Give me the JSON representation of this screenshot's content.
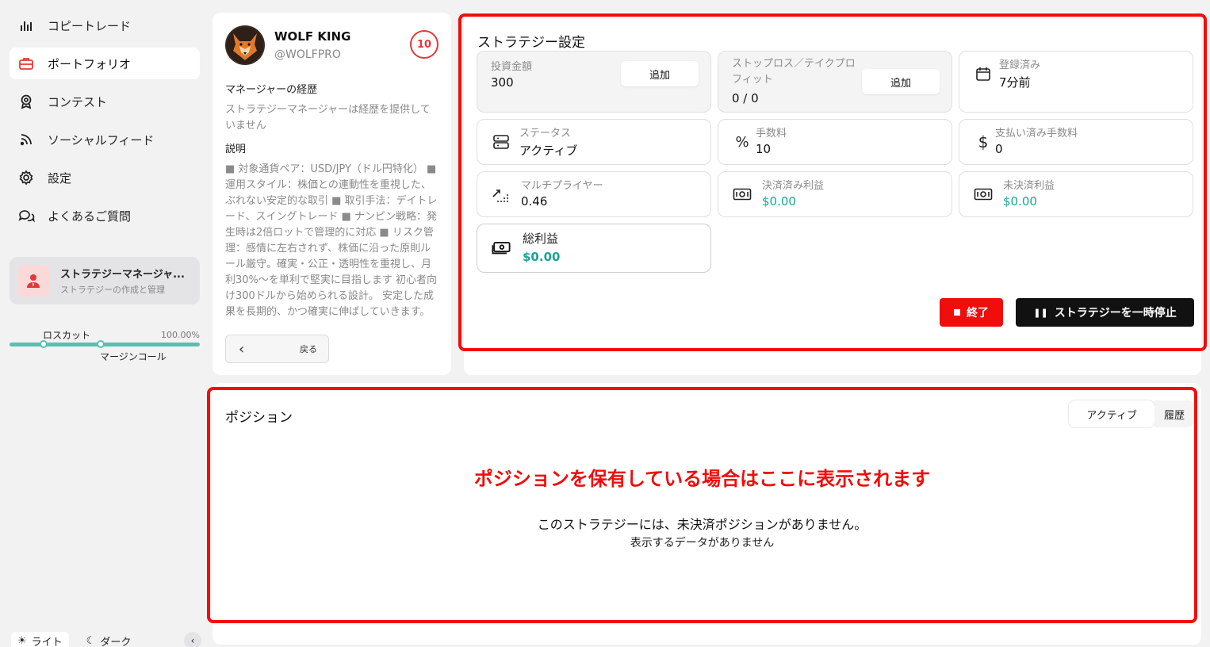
{
  "sidebar": {
    "nav": [
      {
        "label": "コピートレード",
        "icon": "bar-chart-icon"
      },
      {
        "label": "ポートフォリオ",
        "icon": "briefcase-icon"
      },
      {
        "label": "コンテスト",
        "icon": "award-icon"
      },
      {
        "label": "ソーシャルフィード",
        "icon": "rss-icon"
      },
      {
        "label": "設定",
        "icon": "gear-icon"
      },
      {
        "label": "よくあるご質問",
        "icon": "chat-icon"
      }
    ],
    "active_index": 1,
    "manager_card": {
      "title": "ストラテジーマネージャ...",
      "subtitle": "ストラテジーの作成と管理"
    },
    "risk": {
      "stop_label": "ロスカット",
      "percent": "100.00%",
      "margin_label": "マージンコール"
    },
    "theme": {
      "light": "ライト",
      "dark": "ダーク"
    }
  },
  "profile": {
    "name": "WOLF KING",
    "handle": "@WOLFPRO",
    "score": "10",
    "history_title": "マネージャーの経歴",
    "history_text": "ストラテジーマネージャーは経歴を提供していません",
    "desc_title": "説明",
    "description": "■ 対象通貨ペア：USD/JPY（ドル円特化） ■ 運用スタイル：株価との連動性を重視した、ぶれない安定的な取引 ■ 取引手法：デイトレード、スイングトレード ■ ナンピン戦略：発生時は2倍ロットで管理的に対応 ■ リスク管理：感情に左右されず、株価に沿った原則ルール厳守。確実・公正・透明性を重視し、月利30%〜を単利で堅実に目指します 初心者向け300ドルから始められる設計。 安定した成果を長期的、かつ確実に伸ばしていきます。",
    "back_label": "戻る"
  },
  "strategy": {
    "title": "ストラテジー設定",
    "investment": {
      "label": "投資金額",
      "value": "300",
      "button": "追加"
    },
    "sltp": {
      "label": "ストップロス／テイクプロフィット",
      "value": "0 / 0",
      "button": "追加"
    },
    "registered": {
      "label": "登録済み",
      "value": "7分前"
    },
    "status": {
      "label": "ステータス",
      "value": "アクティブ"
    },
    "fee": {
      "label": "手数料",
      "value": "10"
    },
    "paid_fee": {
      "label": "支払い済み手数料",
      "value": "0"
    },
    "multiplier": {
      "label": "マルチプライヤー",
      "value": "0.46"
    },
    "realized": {
      "label": "決済済み利益",
      "value": "$0.00"
    },
    "unrealized": {
      "label": "未決済利益",
      "value": "$0.00"
    },
    "total": {
      "label": "総利益",
      "value": "$0.00"
    },
    "end_button": "終了",
    "pause_button": "ストラテジーを一時停止"
  },
  "positions": {
    "title": "ポジション",
    "tabs": [
      "アクティブ",
      "履歴"
    ],
    "annotation": "ポジションを保有している場合はここに表示されます",
    "empty_main": "このストラテジーには、未決済ポジションがありません。",
    "empty_sub": "表示するデータがありません"
  },
  "colors": {
    "accent_red": "#f20c0c",
    "teal": "#1aa593",
    "slider": "#5bbfb0"
  }
}
